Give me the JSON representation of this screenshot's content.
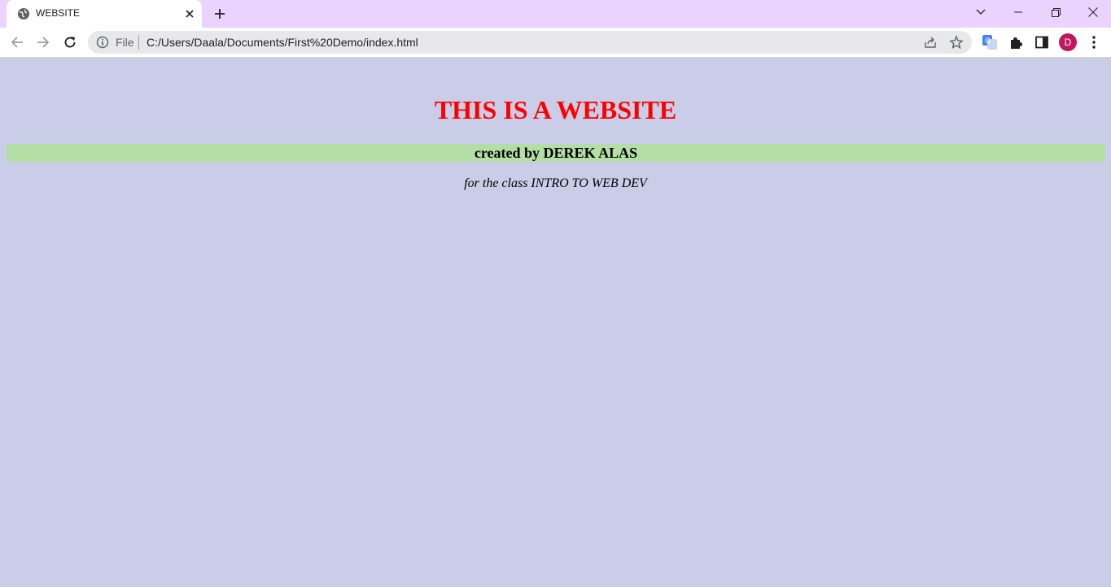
{
  "browser": {
    "tab": {
      "title": "WEBSITE"
    },
    "address": {
      "scheme_label": "File",
      "url": "C:/Users/Daala/Documents/First%20Demo/index.html"
    },
    "profile_initial": "D",
    "colors": {
      "tabstrip": "#ead4ff",
      "omnibox": "#e8e8ea",
      "avatar": "#c2185b"
    }
  },
  "page": {
    "heading": "THIS IS A WEBSITE",
    "credit": "created by DEREK ALAS",
    "class_line": "for the class INTRO TO WEB DEV",
    "colors": {
      "background": "#cacde8",
      "heading": "#ff0000",
      "credit_bar": "#b3dea5"
    }
  }
}
